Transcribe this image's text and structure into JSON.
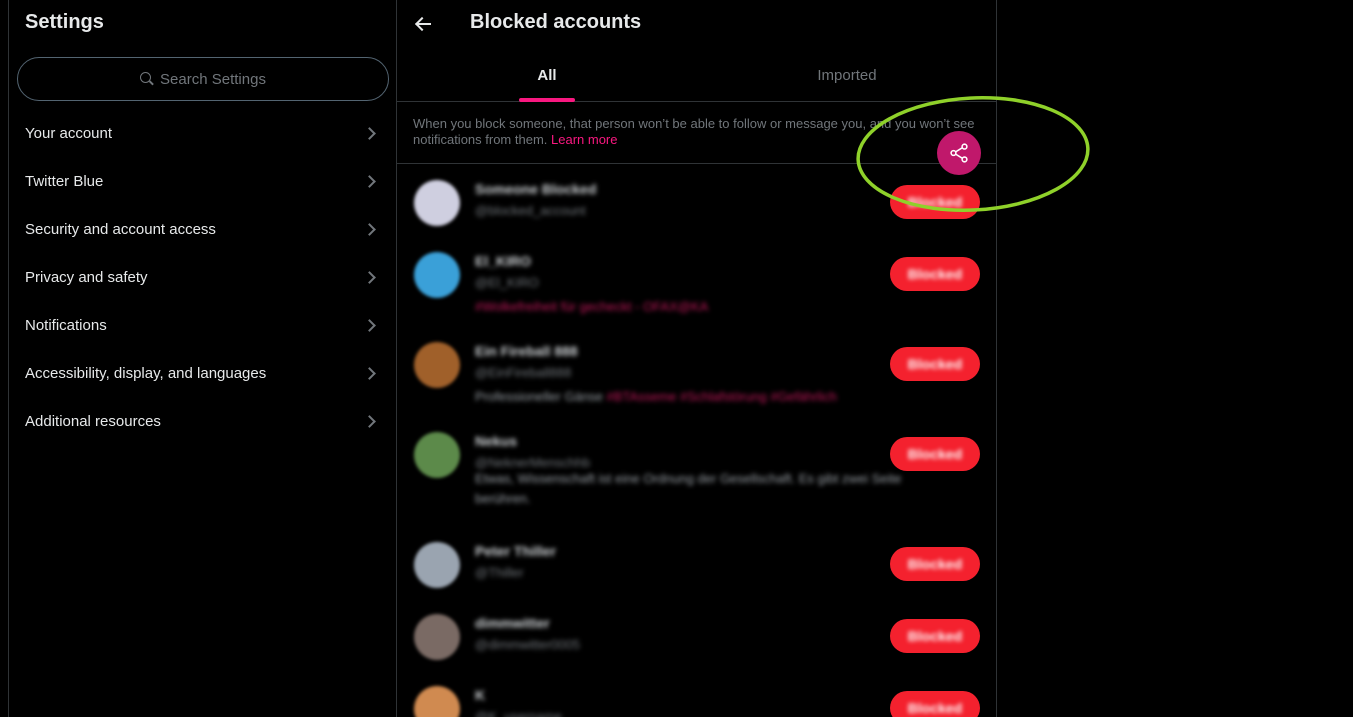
{
  "settings": {
    "title": "Settings",
    "search_placeholder": "Search Settings",
    "items": [
      {
        "label": "Your account"
      },
      {
        "label": "Twitter Blue"
      },
      {
        "label": "Security and account access"
      },
      {
        "label": "Privacy and safety"
      },
      {
        "label": "Notifications"
      },
      {
        "label": "Accessibility, display, and languages"
      },
      {
        "label": "Additional resources"
      }
    ]
  },
  "blocked": {
    "title": "Blocked accounts",
    "tabs": [
      {
        "label": "All",
        "active": true
      },
      {
        "label": "Imported",
        "active": false
      }
    ],
    "info_text": "When you block someone, that person won’t be able to follow or message you, and you won’t see notifications from them.",
    "learn_more": "Learn more",
    "accounts": [
      {
        "name": "Someone Blocked",
        "handle": "@blocked_account",
        "bio": "",
        "bio_pink": "",
        "button": "Blocked",
        "avatar_color": "#cfcfe0"
      },
      {
        "name": "El_KIRO",
        "handle": "@El_KIRO",
        "bio": "",
        "bio_pink": "#Wolkefreiheit für gecheckt - OFAX@KA",
        "button": "Blocked",
        "avatar_color": "#3aa0d8"
      },
      {
        "name": "Ein Fireball 888",
        "handle": "@EinFireball888",
        "bio": "Professioneller Gänse",
        "bio_pink": "#BTAsseme #Schlafstörung #Gefährlich",
        "button": "Blocked",
        "avatar_color": "#a0602a"
      },
      {
        "name": "Nekus",
        "handle": "@NeknerMenschhb",
        "bio": "Etwas, Wissenschaft ist eine Ordnung der Gesellschaft. Es gibt zwei Seite berühren.",
        "bio_pink": "",
        "button": "Blocked",
        "avatar_color": "#5c8a4a"
      },
      {
        "name": "Peter Thiller",
        "handle": "@Thiller",
        "bio": "",
        "bio_pink": "",
        "button": "Blocked",
        "avatar_color": "#9aa4b0"
      },
      {
        "name": "dimmwitter",
        "handle": "@dimmwitter0005",
        "bio": "",
        "bio_pink": "",
        "button": "Blocked",
        "avatar_color": "#7a6a64"
      },
      {
        "name": "K",
        "handle": "@K_username",
        "bio": "",
        "bio_pink": "",
        "button": "Blocked",
        "avatar_color": "#d08a50"
      }
    ]
  },
  "share": {
    "icon": "share-icon",
    "color": "#c0186b"
  },
  "annotation": {
    "color": "#8fd12a"
  }
}
